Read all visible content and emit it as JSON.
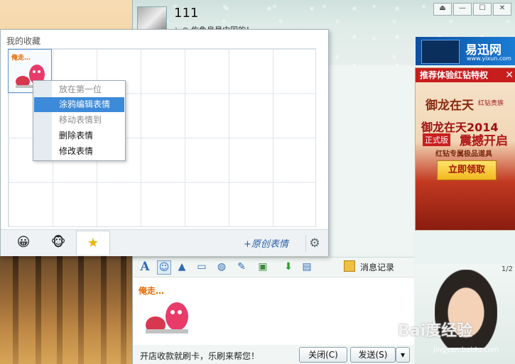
{
  "chat": {
    "contact_name": "111",
    "status_text": "☆ ⊙ 佐鱼良是中国的！",
    "window_buttons": [
      "⏏",
      "—",
      "☐",
      "✕"
    ]
  },
  "ads": {
    "yixun_brand": "易迅网",
    "yixun_url": "www.yixun.com",
    "game_bar_title": "推荐体验红钻特权",
    "game_bar_close": "✕",
    "game_logo": "御龙在天",
    "game_brand": "红钻贵族",
    "headline_1": "御龙在天2014",
    "badge": "正式版",
    "headline_2": "震撼开启",
    "sub_line": "红钻专属极品道具",
    "cta": "立即领取"
  },
  "toolbar": {
    "icons": [
      "font-icon",
      "emoji-icon",
      "shake-icon",
      "screenshot-icon",
      "voice-icon",
      "edit-icon",
      "image-icon",
      "send-file-icon",
      "share-screen-icon"
    ],
    "message_record_label": "消息记录"
  },
  "input": {
    "sticker_caption": "俺走…"
  },
  "footer": {
    "tip_text": "开店收款就刷卡，乐刷来帮您！",
    "close_label": "关闭(C)",
    "send_label": "发送(S)",
    "send_dropdown": "▾"
  },
  "photo": {
    "counter": "1/2"
  },
  "watermark": {
    "main": "Bai度经验",
    "sub": "jingyan.baidu.com"
  },
  "favorites": {
    "title": "我的收藏",
    "cell_sticker_caption": "俺走…",
    "add_original_label": "+原创表情",
    "tabs": [
      {
        "icon": "😀",
        "name": "default-emoji-tab"
      },
      {
        "icon": "🐵",
        "name": "monkey-emoji-tab"
      },
      {
        "icon": "★",
        "name": "favorites-tab"
      }
    ],
    "settings_icon": "⚙"
  },
  "context_menu": {
    "items": [
      {
        "label": "放在第一位",
        "state": "disabled"
      },
      {
        "label": "涂鸦编辑表情",
        "state": "selected"
      },
      {
        "label": "移动表情到",
        "state": "disabled"
      },
      {
        "label": "删除表情",
        "state": "enabled"
      },
      {
        "label": "修改表情",
        "state": "enabled"
      }
    ]
  },
  "colors": {
    "menu_highlight": "#3c8ad8",
    "ad_red": "#c81d1d",
    "link_blue": "#2b63a8"
  }
}
